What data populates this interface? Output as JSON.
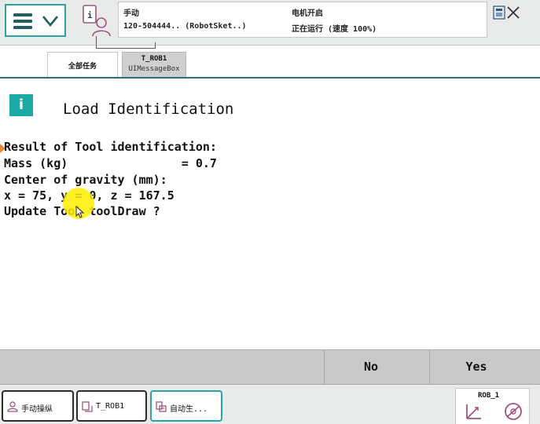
{
  "status_bar": {
    "mode": "手动",
    "controller": "120-504444.. (RobotSket..)",
    "motor_state": "电机开启",
    "run_status": "正在运行 (速度 100%)"
  },
  "tabs": {
    "all_tasks": "全部任务",
    "active_tab_title": "T_ROB1",
    "active_tab_subtitle": "UIMessageBox"
  },
  "message": {
    "icon_letter": "i",
    "title": "Load Identification",
    "lines": [
      "Result of Tool identification:",
      "Mass (kg)                = 0.7",
      "Center of gravity (mm):",
      "x = 75, y = 0, z = 167.5",
      "Update Tool toolDraw ?"
    ]
  },
  "buttons": {
    "no": "No",
    "yes": "Yes"
  },
  "taskbar": {
    "items": [
      {
        "label": "手动操纵",
        "icon": "jog-icon"
      },
      {
        "label": "T_ROB1",
        "icon": "task-icon"
      },
      {
        "label": "自动生...",
        "icon": "auto-production-icon"
      }
    ],
    "quickset_label": "ROB_1"
  },
  "colors": {
    "accent": "#2ba3a6",
    "info_icon": "#1ba9a4",
    "button_bar": "#c9c9c9",
    "touch_indicator": "#ffee00",
    "marker": "#e08a2a"
  }
}
